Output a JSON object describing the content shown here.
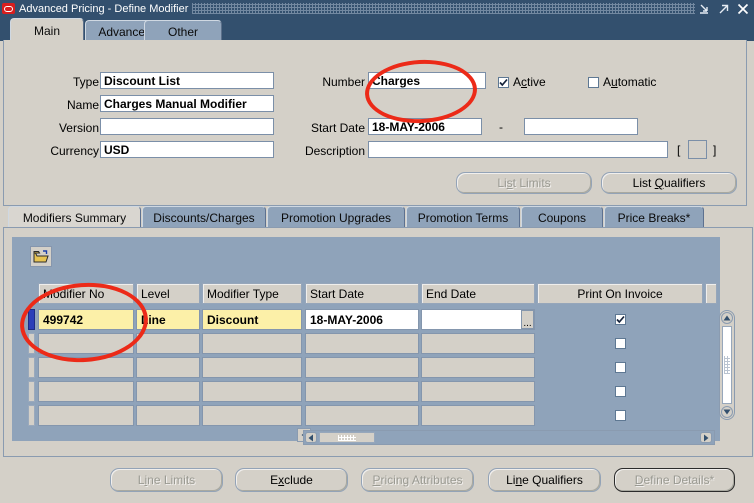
{
  "window": {
    "title": "Advanced Pricing - Define Modifier",
    "logo_icon": "oracle-logo-icon",
    "controls": [
      {
        "name": "minimize-button",
        "icon": "minimize-icon"
      },
      {
        "name": "maximize-button",
        "icon": "maximize-icon"
      },
      {
        "name": "close-button",
        "icon": "close-icon"
      }
    ]
  },
  "top_tabs": [
    {
      "label": "Main",
      "active": true
    },
    {
      "label": "Advanced",
      "active": false
    },
    {
      "label": "Other",
      "active": false
    }
  ],
  "form": {
    "type_label": "Type",
    "type_value": "Discount List",
    "name_label": "Name",
    "name_value": "Charges Manual Modifier",
    "version_label": "Version",
    "version_value": "",
    "currency_label": "Currency",
    "currency_value": "USD",
    "number_label": "Number",
    "number_value": "Charges",
    "start_date_label": "Start Date",
    "start_date_value": "18-MAY-2006",
    "date_separator": "-",
    "end_date_value": "",
    "description_label": "Description",
    "description_value": "",
    "bracket_open": "[",
    "bracket_close": "]",
    "active_label": "Active",
    "active_mnemonic": "c",
    "active_checked": true,
    "automatic_label": "Automatic",
    "automatic_mnemonic": "u",
    "automatic_checked": false
  },
  "panel_buttons": [
    {
      "label": "List Limits",
      "mnemonic": "s",
      "disabled": true,
      "name": "list-limits-button"
    },
    {
      "label": "List Qualifiers",
      "mnemonic": "Q",
      "disabled": false,
      "name": "list-qualifiers-button"
    }
  ],
  "lower_tabs": [
    {
      "label": "Modifiers Summary",
      "active": true
    },
    {
      "label": "Discounts/Charges",
      "active": false
    },
    {
      "label": "Promotion Upgrades",
      "active": false
    },
    {
      "label": "Promotion Terms",
      "active": false
    },
    {
      "label": "Coupons",
      "active": false
    },
    {
      "label": "Price Breaks*",
      "active": false
    }
  ],
  "grid_toolbar": {
    "folder_button_name": "open-folder-button",
    "folder_icon": "folder-open-icon"
  },
  "grid": {
    "columns": [
      {
        "label": "Modifier No",
        "align": "left"
      },
      {
        "label": "Level",
        "align": "left"
      },
      {
        "label": "Modifier Type",
        "align": "left"
      },
      {
        "label": "Start Date",
        "align": "left"
      },
      {
        "label": "End Date",
        "align": "left"
      },
      {
        "label": "Print On Invoice",
        "align": "center"
      }
    ],
    "rows": [
      {
        "current": true,
        "modifier_no": "499742",
        "level": "Line",
        "modifier_type": "Discount",
        "start_date": "18-MAY-2006",
        "end_date": "",
        "print_on_invoice": true,
        "lov_label": "..."
      },
      {
        "current": false,
        "modifier_no": "",
        "level": "",
        "modifier_type": "",
        "start_date": "",
        "end_date": "",
        "print_on_invoice": false
      },
      {
        "current": false,
        "modifier_no": "",
        "level": "",
        "modifier_type": "",
        "start_date": "",
        "end_date": "",
        "print_on_invoice": false
      },
      {
        "current": false,
        "modifier_no": "",
        "level": "",
        "modifier_type": "",
        "start_date": "",
        "end_date": "",
        "print_on_invoice": false
      },
      {
        "current": false,
        "modifier_no": "",
        "level": "",
        "modifier_type": "",
        "start_date": "",
        "end_date": "",
        "print_on_invoice": false
      }
    ]
  },
  "bottom_buttons": [
    {
      "label": "Line Limits",
      "mnemonic": "i",
      "disabled": true,
      "focused": false,
      "name": "line-limits-button"
    },
    {
      "label": "Exclude",
      "mnemonic": "x",
      "disabled": false,
      "focused": false,
      "name": "exclude-button"
    },
    {
      "label": "Pricing Attributes",
      "mnemonic": "P",
      "disabled": true,
      "focused": false,
      "name": "pricing-attributes-button"
    },
    {
      "label": "Line Qualifiers",
      "mnemonic": "n",
      "disabled": false,
      "focused": false,
      "name": "line-qualifiers-button"
    },
    {
      "label": "Define Details*",
      "mnemonic": "D",
      "disabled": true,
      "focused": true,
      "name": "define-details-button"
    }
  ],
  "annotations": {
    "highlight_number_field": "Charges",
    "highlight_modifier_no": "499742",
    "color": "#ec2a18"
  },
  "colors": {
    "titlebar": "#33506e",
    "panel": "#d4d0c8",
    "tab_inactive": "#8fa3ba",
    "grid_back": "#8fa3ba",
    "cell_highlight": "#fcf0a8",
    "record_indicator": "#2b3fb8"
  }
}
